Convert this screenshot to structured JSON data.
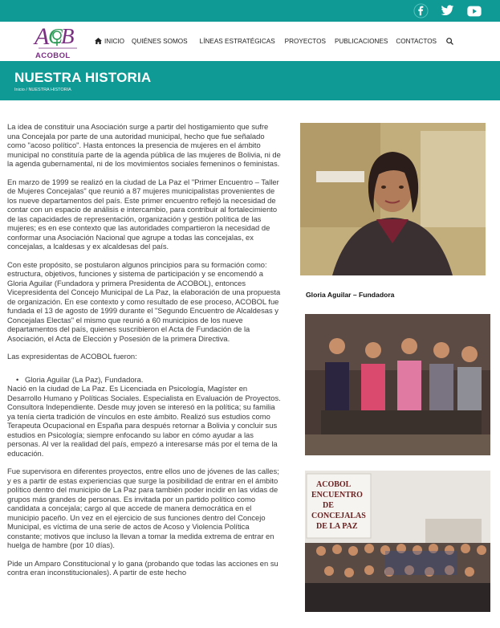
{
  "social": {
    "icons": [
      "facebook-icon",
      "twitter-icon",
      "youtube-icon"
    ]
  },
  "logo": {
    "name": "ACOBOL",
    "monogram": "ACB"
  },
  "nav": {
    "items": [
      {
        "label": "INICIO",
        "icon": "home-icon"
      },
      {
        "label": "QUIÉNES SOMOS"
      },
      {
        "label": "LÍNEAS ESTRATÉGICAS"
      },
      {
        "label": "PROYECTOS"
      },
      {
        "label": "PUBLICACIONES"
      },
      {
        "label": "CONTACTOS"
      }
    ]
  },
  "banner": {
    "title": "NUESTRA HISTORIA",
    "breadcrumb_home": "Inicio",
    "breadcrumb_sep": " / ",
    "breadcrumb_current": "NUESTRA HISTORIA"
  },
  "article": {
    "p1": "La idea de constituir una Asociación surge a partir del hostigamiento que sufre una Concejala por parte de una autoridad municipal, hecho que fue señalado como \"acoso político\". Hasta entonces la presencia de mujeres en el ámbito municipal no constituía parte de la agenda pública de las mujeres de Bolivia, ni de la agenda gubernamental, ni de los movimientos sociales femeninos o feministas.",
    "p2": "En marzo de 1999 se realizó en la ciudad de La Paz el \"Primer Encuentro – Taller de Mujeres Concejalas\" que reunió a 87 mujeres municipalistas provenientes de los nueve departamentos del país. Este primer encuentro reflejó la necesidad de contar con un espacio de análisis e intercambio, para contribuir al fortalecimiento de las capacidades de representación, organización y gestión política de las mujeres; es en ese contexto que las autoridades compartieron la necesidad de conformar una Asociación Nacional que agrupe a todas las concejalas, ex concejalas, a lcaldesas y ex alcaldesas del país.",
    "p3": "Con este propósito, se postularon algunos principios para su formación como: estructura, objetivos, funciones y sistema de participación y se encomendó a Gloria Aguilar (Fundadora y primera Presidenta de ACOBOL), entonces Vicepresidenta del Concejo Municipal de La Paz, la elaboración de una propuesta de organización. En ese contexto y como resultado de ese proceso, ACOBOL fue fundada el 13 de agosto de 1999 durante el \"Segundo Encuentro de Alcaldesas y Concejalas Electas\" el mismo que reunió a 60 municipios de los nueve departamentos del país, quienes suscribieron el Acta de Fundación de la Asociación, el Acta de Elección y Posesión de la primera Directiva.",
    "p4": "Las expresidentas de ACOBOL fueron:",
    "bullet": "Gloria Aguilar (La Paz), Fundadora.",
    "p5": "Nació en la ciudad de La Paz. Es Licenciada en Psicología, Magíster en Desarrollo Humano y Políticas Sociales. Especialista en Evaluación de Proyectos. Consultora Independiente. Desde muy joven se interesó en la política; su familia ya tenía cierta tradición de vínculos en este ámbito. Realizó sus estudios como Terapeuta Ocupacional en España para después retornar a Bolivia y concluir sus estudios en Psicología; siempre enfocando su labor en cómo ayudar a las personas. Al ver la realidad del país, empezó a interesarse más por el tema de la educación.",
    "p6": "Fue supervisora en diferentes proyectos, entre ellos uno de jóvenes de las calles; y es a partir de estas experiencias que surge la posibilidad de entrar en el ámbito político dentro del municipio de La Paz para también poder incidir en las vidas de grupos más grandes de personas. Es invitada por un partido político como candidata a concejala; cargo al que accede de manera democrática en el municipio paceño. Un vez en el ejercicio de sus funciones dentro del Concejo Municipal, es víctima de una serie de actos de Acoso y Violencia Política constante; motivos que incluso la llevan a tomar la medida extrema de entrar en huelga de hambre (por 10 días).",
    "p7": "Pide un Amparo Constitucional y lo gana (probando que todas las acciones en su contra eran inconstitucionales). A partir de este hecho"
  },
  "sidebar": {
    "caption": "Gloria Aguilar – Fundadora",
    "banner_text": "ACOBOL ENCUENTRO DE CONCEJALAS DE LA PAZ"
  },
  "colors": {
    "teal": "#0f9a96",
    "logo_purple": "#7a2f82",
    "logo_green": "#2e9b58"
  }
}
